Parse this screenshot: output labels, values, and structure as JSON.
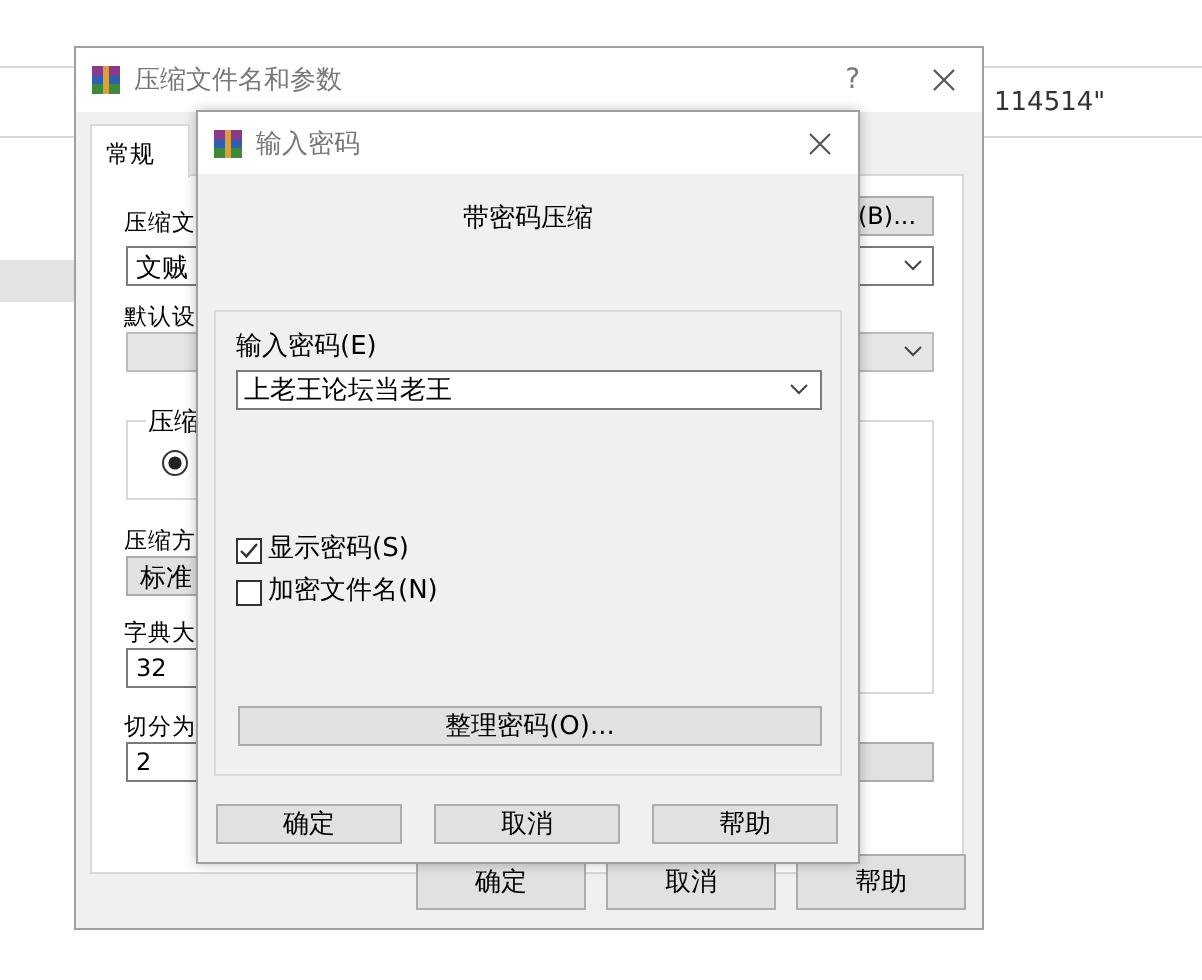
{
  "background": {
    "text": "114514\""
  },
  "main_window": {
    "title": "压缩文件名和参数",
    "help": "?",
    "tabs": [
      {
        "label": "常规",
        "selected": true
      }
    ],
    "left_items": [
      {
        "kind": "label",
        "text": "压缩文"
      },
      {
        "kind": "input",
        "text": "文贼"
      },
      {
        "kind": "label",
        "text": "默认设"
      },
      {
        "kind": "disabled_combo"
      },
      {
        "kind": "group",
        "text": "压缩",
        "selected": true
      },
      {
        "kind": "label",
        "text": "压缩方"
      },
      {
        "kind": "select",
        "text": "标准"
      },
      {
        "kind": "label",
        "text": "字典大"
      },
      {
        "kind": "input",
        "text": "32"
      },
      {
        "kind": "label",
        "text": "切分为"
      },
      {
        "kind": "input",
        "text": "2"
      }
    ],
    "right_items": [
      {
        "kind": "button",
        "text": "(B)..."
      },
      {
        "kind": "combo"
      },
      {
        "kind": "disabled_combo"
      },
      {
        "kind": "group"
      },
      {
        "kind": "button"
      }
    ],
    "buttons": [
      "确定",
      "取消",
      "帮助"
    ]
  },
  "dialog": {
    "title": "输入密码",
    "heading": "带密码压缩",
    "password_label": "输入密码(E)",
    "password": "上老王论坛当老王",
    "options": [
      {
        "label": "显示密码(S)",
        "checked": true
      },
      {
        "label": "加密文件名(N)",
        "checked": false
      }
    ],
    "organize_button": "整理密码(O)...",
    "buttons": [
      "确定",
      "取消",
      "帮助"
    ]
  }
}
